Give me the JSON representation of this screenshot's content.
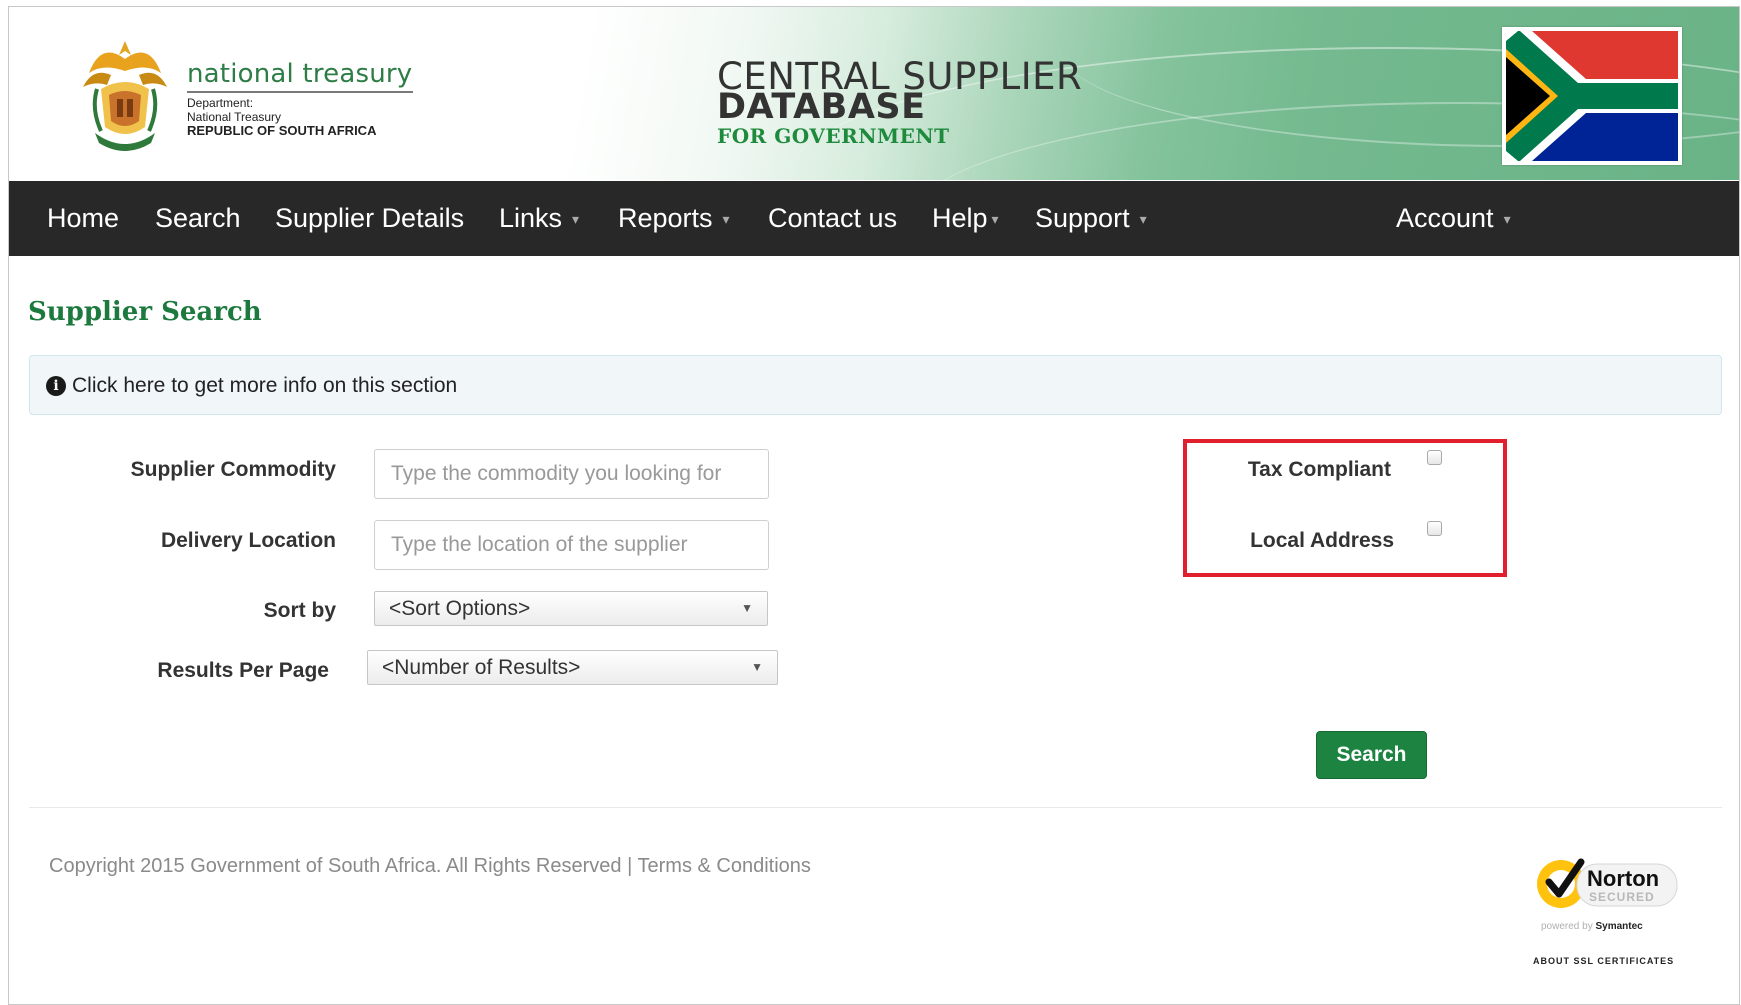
{
  "header": {
    "org_name": "national treasury",
    "org_line1": "Department:",
    "org_line2": "National Treasury",
    "org_line3": "REPUBLIC OF SOUTH AFRICA",
    "title_line1": "CENTRAL SUPPLIER",
    "title_line2": "DATABASE",
    "title_line3": "FOR GOVERNMENT",
    "logo_icon": "coat-of-arms-icon",
    "flag_icon": "south-africa-flag-icon"
  },
  "nav": {
    "items": [
      {
        "label": "Home"
      },
      {
        "label": "Search"
      },
      {
        "label": "Supplier Details"
      },
      {
        "label": "Links",
        "dropdown": true
      },
      {
        "label": "Reports",
        "dropdown": true
      },
      {
        "label": "Contact us"
      },
      {
        "label": "Help",
        "dropdown": true
      },
      {
        "label": "Support",
        "dropdown": true
      },
      {
        "label": "Account",
        "dropdown": true
      }
    ],
    "caret": "▾"
  },
  "page": {
    "title": "Supplier Search",
    "info_text": "Click here to get more info on this section"
  },
  "form": {
    "commodity": {
      "label": "Supplier Commodity",
      "placeholder": "Type the commodity you looking for",
      "value": ""
    },
    "location": {
      "label": "Delivery Location",
      "placeholder": "Type the location of the supplier",
      "value": ""
    },
    "sort": {
      "label": "Sort by",
      "selected": "<Sort Options>"
    },
    "results": {
      "label": "Results Per Page",
      "selected": "<Number of Results>"
    },
    "tax_compliant": {
      "label": "Tax Compliant",
      "checked": false
    },
    "local_address": {
      "label": "Local Address",
      "checked": false
    },
    "search_button": "Search"
  },
  "footer": {
    "copyright": "Copyright 2015 Government of South Africa. All Rights Reserved",
    "separator": "|",
    "terms": "Terms & Conditions",
    "norton_brand": "Norton",
    "norton_secured": "SECURED",
    "norton_powered_prefix": "powered by",
    "norton_powered_brand": "Symantec",
    "norton_ssl": "ABOUT SSL CERTIFICATES"
  },
  "colors": {
    "brand_green": "#1d8340",
    "nav_bg": "#282828",
    "highlight_red": "#e0202e"
  }
}
